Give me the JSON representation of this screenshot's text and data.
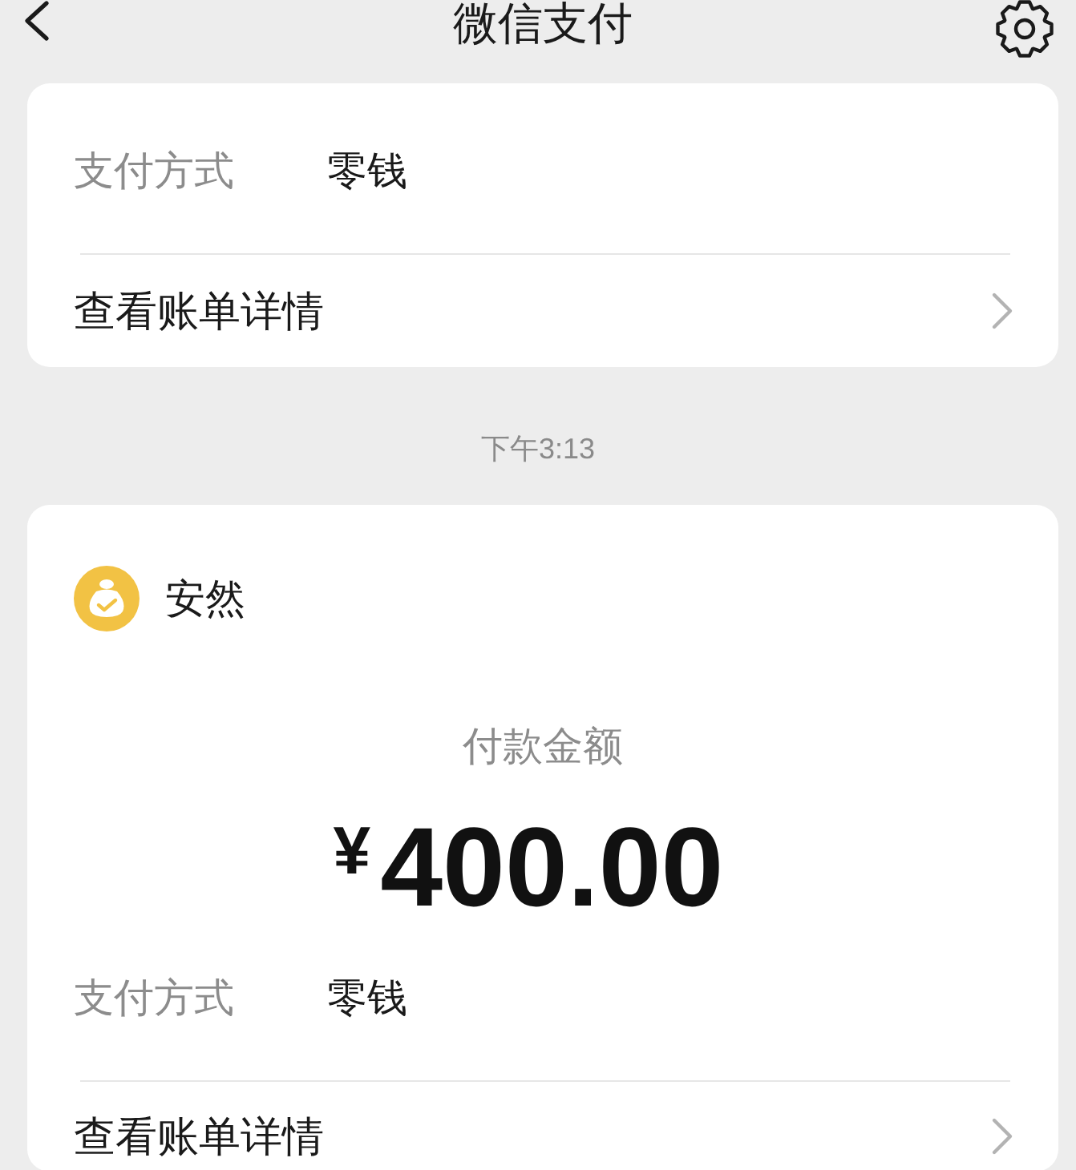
{
  "header": {
    "title": "微信支付"
  },
  "transactions": [
    {
      "fields": [
        {
          "label": "支付方式",
          "value": "零钱"
        }
      ],
      "details_link": "查看账单详情"
    },
    {
      "time": "下午3:13",
      "payee": "安然",
      "amount_label": "付款金额",
      "amount": "$^{¥}$400.00",
      "fields": [
        {
          "label": "支付方式",
          "value": "零钱"
        }
      ],
      "details_link": "查看账单详情"
    }
  ]
}
